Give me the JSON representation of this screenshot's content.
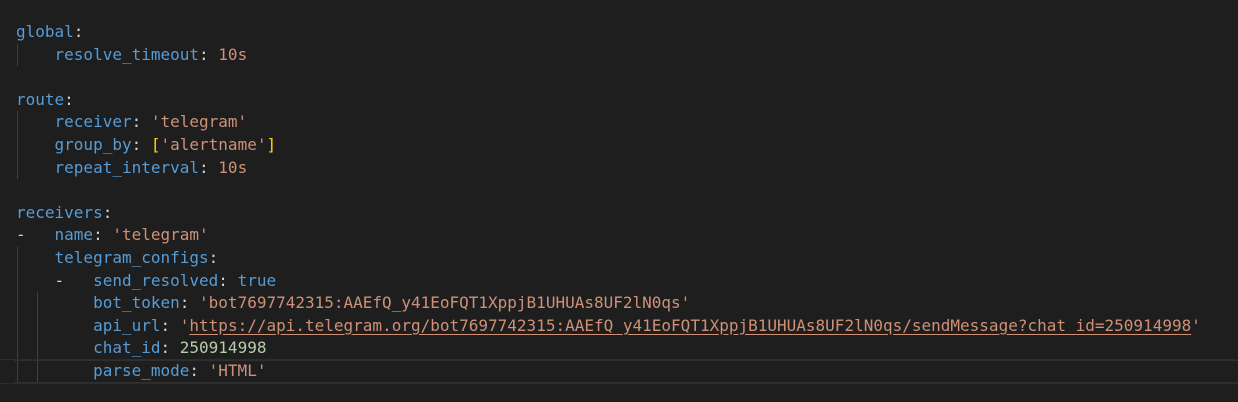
{
  "editor": {
    "language": "yaml",
    "lines": {
      "l1": {
        "key": "global"
      },
      "l2": {
        "key": "resolve_timeout",
        "value": "10s"
      },
      "l4": {
        "key": "route"
      },
      "l5": {
        "key": "receiver",
        "value": "'telegram'"
      },
      "l6": {
        "key": "group_by",
        "open": "[",
        "value": "'alertname'",
        "close": "]"
      },
      "l7": {
        "key": "repeat_interval",
        "value": "10s"
      },
      "l9": {
        "key": "receivers"
      },
      "l10": {
        "dash": "- ",
        "key": "name",
        "value": "'telegram'"
      },
      "l11": {
        "key": "telegram_configs"
      },
      "l12": {
        "dash": "- ",
        "key": "send_resolved",
        "value": "true"
      },
      "l13": {
        "key": "bot_token",
        "value": "'bot7697742315:AAEfQ_y41EoFQT1XppjB1UHUAs8UF2lN0qs'"
      },
      "l14": {
        "key": "api_url",
        "quote_open": "'",
        "url": "https://api.telegram.org/bot7697742315:AAEfQ_y41EoFQT1XppjB1UHUAs8UF2lN0qs/sendMessage?chat_id=250914998",
        "quote_close": "'"
      },
      "l15": {
        "key": "chat_id",
        "value": "250914998"
      },
      "l16": {
        "key": "parse_mode",
        "value": "'HTML'"
      }
    }
  }
}
